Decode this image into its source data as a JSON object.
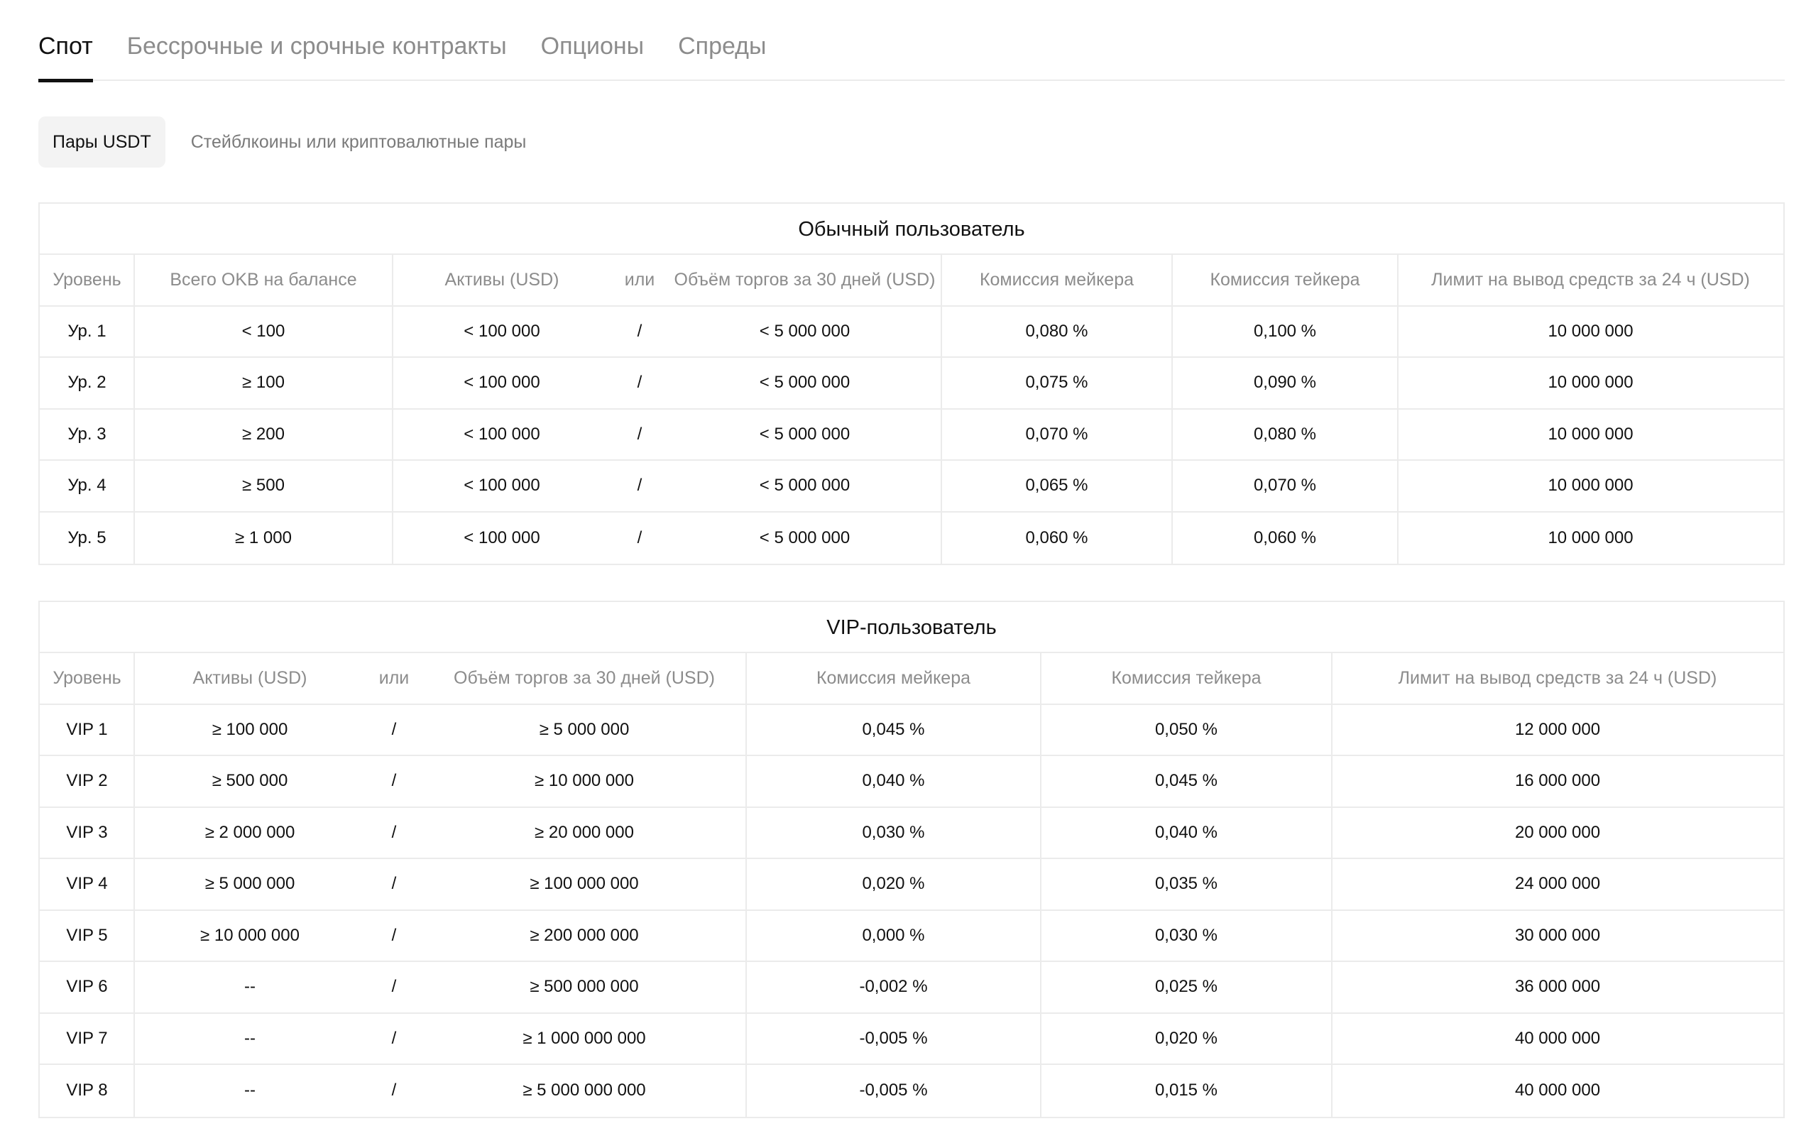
{
  "tabs": [
    {
      "label": "Спот",
      "active": true
    },
    {
      "label": "Бессрочные и срочные контракты",
      "active": false
    },
    {
      "label": "Опционы",
      "active": false
    },
    {
      "label": "Спреды",
      "active": false
    }
  ],
  "subtabs": [
    {
      "label": "Пары USDT",
      "active": true
    },
    {
      "label": "Стейблкоины или криптовалютные пары",
      "active": false
    }
  ],
  "regular": {
    "title": "Обычный пользователь",
    "headers": {
      "level": "Уровень",
      "okb": "Всего OKB на балансе",
      "assets": "Активы (USD)",
      "or": "или",
      "volume": "Объём торгов за 30 дней (USD)",
      "maker": "Комиссия мейкера",
      "taker": "Комиссия тейкера",
      "limit": "Лимит на вывод средств за 24 ч (USD)"
    },
    "rows": [
      {
        "level": "Ур. 1",
        "okb": "< 100",
        "assets": "< 100 000",
        "sep": "/",
        "volume": "< 5 000 000",
        "maker": "0,080 %",
        "taker": "0,100 %",
        "limit": "10 000 000"
      },
      {
        "level": "Ур. 2",
        "okb": "≥ 100",
        "assets": "< 100 000",
        "sep": "/",
        "volume": "< 5 000 000",
        "maker": "0,075 %",
        "taker": "0,090 %",
        "limit": "10 000 000"
      },
      {
        "level": "Ур. 3",
        "okb": "≥ 200",
        "assets": "< 100 000",
        "sep": "/",
        "volume": "< 5 000 000",
        "maker": "0,070 %",
        "taker": "0,080 %",
        "limit": "10 000 000"
      },
      {
        "level": "Ур. 4",
        "okb": "≥ 500",
        "assets": "< 100 000",
        "sep": "/",
        "volume": "< 5 000 000",
        "maker": "0,065 %",
        "taker": "0,070 %",
        "limit": "10 000 000"
      },
      {
        "level": "Ур. 5",
        "okb": "≥ 1 000",
        "assets": "< 100 000",
        "sep": "/",
        "volume": "< 5 000 000",
        "maker": "0,060 %",
        "taker": "0,060 %",
        "limit": "10 000 000"
      }
    ]
  },
  "vip": {
    "title": "VIP-пользователь",
    "headers": {
      "level": "Уровень",
      "assets": "Активы (USD)",
      "or": "или",
      "volume": "Объём торгов за 30 дней (USD)",
      "maker": "Комиссия мейкера",
      "taker": "Комиссия тейкера",
      "limit": "Лимит на вывод средств за 24 ч (USD)"
    },
    "rows": [
      {
        "level": "VIP 1",
        "assets": "≥ 100 000",
        "sep": "/",
        "volume": "≥ 5 000 000",
        "maker": "0,045 %",
        "taker": "0,050 %",
        "limit": "12 000 000"
      },
      {
        "level": "VIP 2",
        "assets": "≥ 500 000",
        "sep": "/",
        "volume": "≥ 10 000 000",
        "maker": "0,040 %",
        "taker": "0,045 %",
        "limit": "16 000 000"
      },
      {
        "level": "VIP 3",
        "assets": "≥ 2 000 000",
        "sep": "/",
        "volume": "≥ 20 000 000",
        "maker": "0,030 %",
        "taker": "0,040 %",
        "limit": "20 000 000"
      },
      {
        "level": "VIP 4",
        "assets": "≥ 5 000 000",
        "sep": "/",
        "volume": "≥ 100 000 000",
        "maker": "0,020 %",
        "taker": "0,035 %",
        "limit": "24 000 000"
      },
      {
        "level": "VIP 5",
        "assets": "≥ 10 000 000",
        "sep": "/",
        "volume": "≥ 200 000 000",
        "maker": "0,000 %",
        "taker": "0,030 %",
        "limit": "30 000 000"
      },
      {
        "level": "VIP 6",
        "assets": "--",
        "sep": "/",
        "volume": "≥ 500 000 000",
        "maker": "-0,002 %",
        "taker": "0,025 %",
        "limit": "36 000 000"
      },
      {
        "level": "VIP 7",
        "assets": "--",
        "sep": "/",
        "volume": "≥ 1 000 000 000",
        "maker": "-0,005 %",
        "taker": "0,020 %",
        "limit": "40 000 000"
      },
      {
        "level": "VIP 8",
        "assets": "--",
        "sep": "/",
        "volume": "≥ 5 000 000 000",
        "maker": "-0,005 %",
        "taker": "0,015 %",
        "limit": "40 000 000"
      }
    ]
  }
}
